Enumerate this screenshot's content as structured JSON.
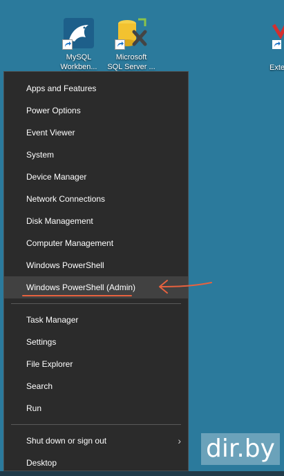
{
  "desktop": {
    "icons": [
      {
        "name": "mysql-workbench",
        "line1": "MySQL",
        "line2": "Workben..."
      },
      {
        "name": "sql-server",
        "line1": "Microsoft",
        "line2": "SQL Server ..."
      }
    ],
    "partial_icon_label": "Exte"
  },
  "menu": {
    "items": [
      "Apps and Features",
      "Power Options",
      "Event Viewer",
      "System",
      "Device Manager",
      "Network Connections",
      "Disk Management",
      "Computer Management",
      "Windows PowerShell",
      "Windows PowerShell (Admin)",
      "Task Manager",
      "Settings",
      "File Explorer",
      "Search",
      "Run",
      "Shut down or sign out",
      "Desktop"
    ],
    "highlighted_item": "Windows PowerShell (Admin)",
    "submenu_chevron": "›"
  },
  "watermark": "dir.by",
  "colors": {
    "desktop_bg": "#2b7a9c",
    "menu_bg": "#2b2b2b",
    "highlight_bg": "#414141",
    "annotation": "#e8623f"
  }
}
